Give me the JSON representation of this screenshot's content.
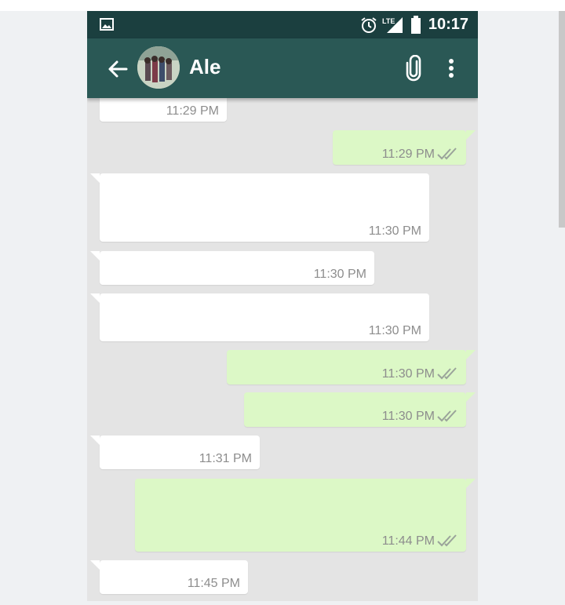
{
  "status_bar": {
    "time": "10:17",
    "network": "LTE"
  },
  "toolbar": {
    "contact_name": "Ale"
  },
  "messages": [
    {
      "direction": "in",
      "time": "11:29 PM"
    },
    {
      "direction": "out",
      "time": "11:29 PM",
      "status": "read"
    },
    {
      "direction": "in",
      "time": "11:30 PM"
    },
    {
      "direction": "in",
      "time": "11:30 PM"
    },
    {
      "direction": "in",
      "time": "11:30 PM"
    },
    {
      "direction": "out",
      "time": "11:30 PM",
      "status": "read"
    },
    {
      "direction": "out",
      "time": "11:30 PM",
      "status": "read"
    },
    {
      "direction": "in",
      "time": "11:31 PM"
    },
    {
      "direction": "out",
      "time": "11:44 PM",
      "status": "read"
    },
    {
      "direction": "in",
      "time": "11:45 PM"
    }
  ],
  "colors": {
    "status_bar": "#1b3f3f",
    "toolbar": "#2a5855",
    "chat_background": "#e4e4e4",
    "incoming_bubble": "#ffffff",
    "outgoing_bubble": "#dcf8c6",
    "read_ticks": "#9aa39a"
  },
  "icons": [
    "gallery-icon",
    "alarm-icon",
    "lte-signal-icon",
    "battery-icon",
    "back-arrow-icon",
    "attach-icon",
    "more-vert-icon"
  ]
}
